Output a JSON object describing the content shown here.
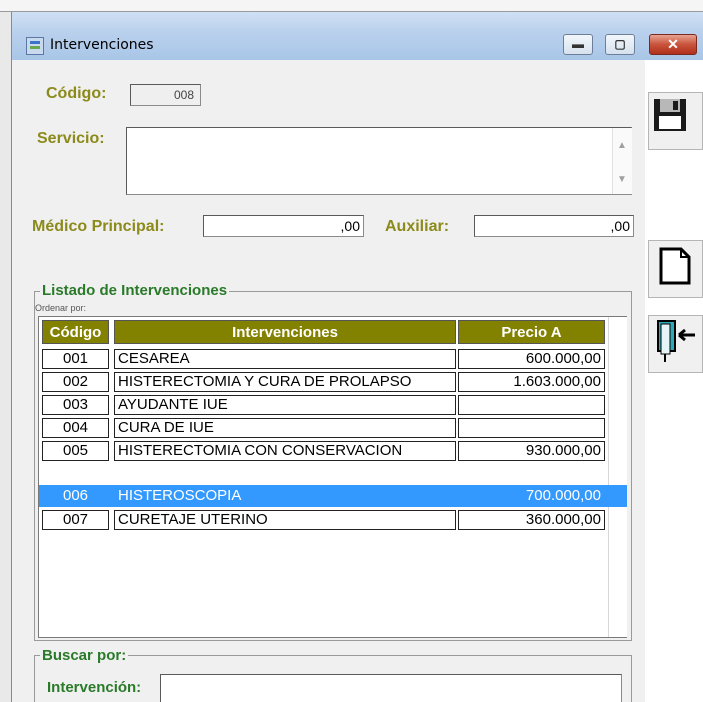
{
  "window": {
    "title": "Intervenciones",
    "buttons": {
      "minimize": "▬",
      "maximize": "▢",
      "close": "✕"
    }
  },
  "form": {
    "codigo_label": "Código:",
    "codigo_value": "008",
    "servicio_label": "Servicio:",
    "servicio_value": "",
    "medico_label": "Médico Principal:",
    "medico_value": ",00",
    "auxiliar_label": "Auxiliar:",
    "auxiliar_value": ",00"
  },
  "listado": {
    "group_title": "Listado de Intervenciones",
    "ordenar_label": "Ordenar por:",
    "columns": [
      "Código",
      "Intervenciones",
      "Precio A"
    ],
    "rows": [
      {
        "codigo": "001",
        "intervencion": "CESAREA",
        "precio": "600.000,00"
      },
      {
        "codigo": "002",
        "intervencion": "HISTERECTOMIA Y CURA DE PROLAPSO",
        "precio": "1.603.000,00"
      },
      {
        "codigo": "003",
        "intervencion": "AYUDANTE IUE",
        "precio": ""
      },
      {
        "codigo": "004",
        "intervencion": "CURA DE IUE",
        "precio": ""
      },
      {
        "codigo": "005",
        "intervencion": "HISTERECTOMIA CON CONSERVACION",
        "precio": "930.000,00"
      },
      {
        "codigo": "006",
        "intervencion": "HISTEROSCOPIA",
        "precio": "700.000,00"
      },
      {
        "codigo": "007",
        "intervencion": "CURETAJE UTERINO",
        "precio": "360.000,00"
      }
    ],
    "selected_row": "006"
  },
  "buscar": {
    "group_title": "Buscar por:",
    "intervencion_label": "Intervención:",
    "intervencion_value": ""
  },
  "toolbar": {
    "icons": [
      "save-icon",
      "new-document-icon",
      "exit-door-icon"
    ]
  },
  "colors": {
    "header_olive": "#838100",
    "label_olive": "#8c8a1a",
    "group_green": "#2a7a2a",
    "selection_blue": "#3399ff"
  }
}
